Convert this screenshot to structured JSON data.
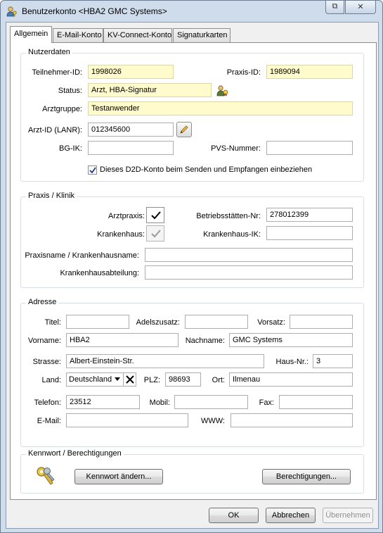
{
  "window": {
    "title": "Benutzerkonto <HBA2 GMC Systems>",
    "restore_glyph": "⧉",
    "close_glyph": "✕"
  },
  "tabs": [
    {
      "label": "Allgemein",
      "active": true
    },
    {
      "label": "E-Mail-Konto",
      "active": false
    },
    {
      "label": "KV-Connect-Konto",
      "active": false
    },
    {
      "label": "Signaturkarten",
      "active": false
    }
  ],
  "nutzerdaten": {
    "title": "Nutzerdaten",
    "teilnehmer_label": "Teilnehmer-ID:",
    "teilnehmer_value": "1998026",
    "praxis_label": "Praxis-ID:",
    "praxis_value": "1989094",
    "status_label": "Status:",
    "status_value": "Arzt, HBA-Signatur",
    "arztgruppe_label": "Arztgruppe:",
    "arztgruppe_value": "Testanwender",
    "arztid_label": "Arzt-ID (LANR):",
    "arztid_value": "012345600",
    "bgik_label": "BG-IK:",
    "bgik_value": "",
    "pvs_label": "PVS-Nummer:",
    "pvs_value": "",
    "d2d_label": "Dieses D2D-Konto beim Senden und Empfangen einbeziehen",
    "d2d_checked": true
  },
  "praxis": {
    "title": "Praxis / Klinik",
    "arztpraxis_label": "Arztpraxis:",
    "arztpraxis_checked": true,
    "krankenhaus_label": "Krankenhaus:",
    "krankenhaus_checked": true,
    "bsnr_label": "Betriebsstätten-Nr:",
    "bsnr_value": "278012399",
    "khik_label": "Krankenhaus-IK:",
    "khik_value": "",
    "praxisname_label": "Praxisname / Krankenhausname:",
    "praxisname_value": "",
    "abteilung_label": "Krankenhausabteilung:",
    "abteilung_value": ""
  },
  "adresse": {
    "title": "Adresse",
    "titel_label": "Titel:",
    "titel_value": "",
    "adel_label": "Adelszusatz:",
    "adel_value": "",
    "vorsatz_label": "Vorsatz:",
    "vorsatz_value": "",
    "vorname_label": "Vorname:",
    "vorname_value": "HBA2",
    "nachname_label": "Nachname:",
    "nachname_value": "GMC Systems",
    "strasse_label": "Strasse:",
    "strasse_value": "Albert-Einstein-Str.",
    "hausnr_label": "Haus-Nr.:",
    "hausnr_value": "3",
    "land_label": "Land:",
    "land_value": "Deutschland",
    "plz_label": "PLZ:",
    "plz_value": "98693",
    "ort_label": "Ort:",
    "ort_value": "Ilmenau",
    "telefon_label": "Telefon:",
    "telefon_value": "23512",
    "mobil_label": "Mobil:",
    "mobil_value": "",
    "fax_label": "Fax:",
    "fax_value": "",
    "email_label": "E-Mail:",
    "email_value": "",
    "www_label": "WWW:",
    "www_value": ""
  },
  "kennwort": {
    "title": "Kennwort / Berechtigungen",
    "kennwort_button": "Kennwort ändern...",
    "berechtigungen_button": "Berechtigungen..."
  },
  "footer": {
    "ok": "OK",
    "abbrechen": "Abbrechen",
    "uebernehmen": "Übernehmen"
  },
  "colors": {
    "required_field_bg": "#fffbcc",
    "window_frame": "#cfdcec"
  },
  "icons": {
    "window": "user-key-icon",
    "status": "user-certificate-icon",
    "arztid": "pencil-icon",
    "kennwort": "keys-icon"
  }
}
